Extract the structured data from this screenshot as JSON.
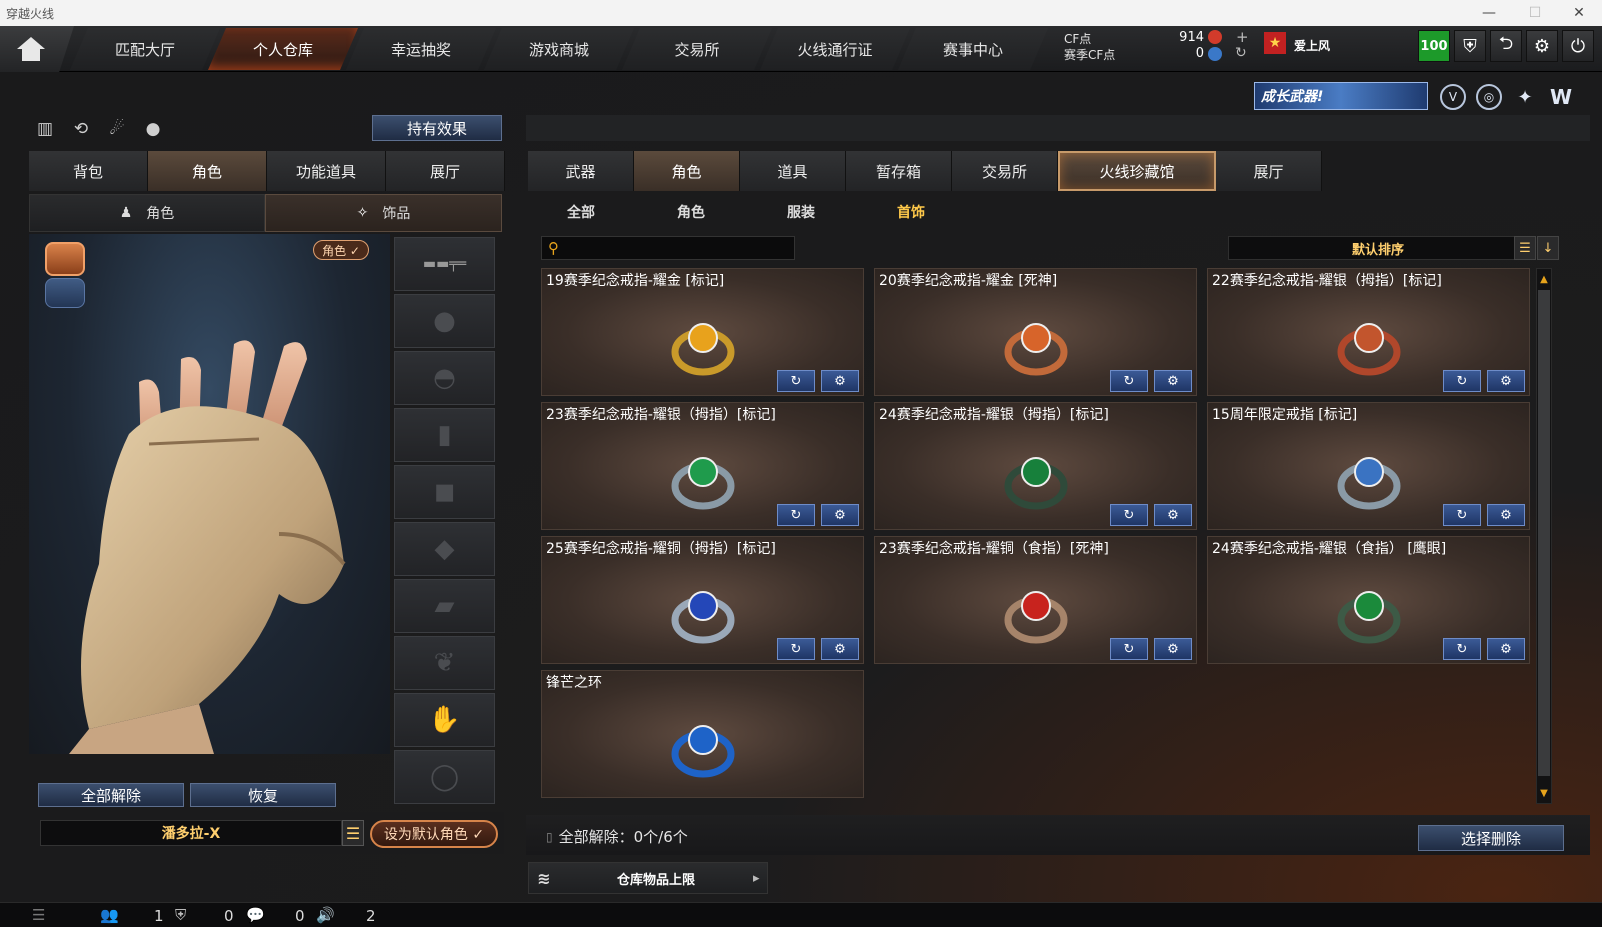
{
  "window": {
    "title": "穿越火线"
  },
  "topnav": {
    "tabs": [
      {
        "label": "匹配大厅"
      },
      {
        "label": "个人仓库"
      },
      {
        "label": "幸运抽奖"
      },
      {
        "label": "游戏商城"
      },
      {
        "label": "交易所"
      },
      {
        "label": "火线通行证"
      },
      {
        "label": "赛事中心"
      }
    ],
    "cf_label": "CF点",
    "cf_value": "914",
    "season_cf_label": "赛季CF点",
    "season_cf_value": "0",
    "username": "爱上风",
    "level_badge": "100",
    "banner_text": "成长武器!"
  },
  "left": {
    "effect_button": "持有效果",
    "tabs": [
      {
        "label": "背包"
      },
      {
        "label": "角色"
      },
      {
        "label": "功能道具"
      },
      {
        "label": "展厅"
      }
    ],
    "subtabs": [
      {
        "label": "角色"
      },
      {
        "label": "饰品"
      }
    ],
    "role_tag": "角色 ✓",
    "unequip_all": "全部解除",
    "restore": "恢复",
    "character_name": "潘多拉-X",
    "set_default": "设为默认角色 ✓"
  },
  "right": {
    "tabs": [
      {
        "label": "武器"
      },
      {
        "label": "角色"
      },
      {
        "label": "道具"
      },
      {
        "label": "暂存箱"
      },
      {
        "label": "交易所"
      },
      {
        "label": "火线珍藏馆"
      },
      {
        "label": "展厅"
      }
    ],
    "filters": [
      {
        "label": "全部"
      },
      {
        "label": "角色"
      },
      {
        "label": "服装"
      },
      {
        "label": "首饰"
      }
    ],
    "search_placeholder": "",
    "sort_label": "默认排序",
    "items": [
      {
        "title": "19赛季纪念戒指-耀金 [标记]",
        "gem": "#e8a21c",
        "band": "#c99a2a"
      },
      {
        "title": "20赛季纪念戒指-耀金 [死神]",
        "gem": "#d7642a",
        "band": "#c26a3a"
      },
      {
        "title": "22赛季纪念戒指-耀银（拇指）[标记]",
        "gem": "#c2552d",
        "band": "#b0472b"
      },
      {
        "title": "23赛季纪念戒指-耀银（拇指）[标记]",
        "gem": "#1f9b4c",
        "band": "#8a9aa6"
      },
      {
        "title": "24赛季纪念戒指-耀银（拇指）[标记]",
        "gem": "#17803b",
        "band": "#2f4a3a"
      },
      {
        "title": "15周年限定戒指 [标记]",
        "gem": "#3a73c2",
        "band": "#8a9aa6"
      },
      {
        "title": "25赛季纪念戒指-耀铜（拇指）[标记]",
        "gem": "#2447b8",
        "band": "#9aa8b8"
      },
      {
        "title": "23赛季纪念戒指-耀铜（食指）[死神]",
        "gem": "#c8231e",
        "band": "#a6846a"
      },
      {
        "title": "24赛季纪念戒指-耀银（食指） [鹰眼]",
        "gem": "#1b8a3b",
        "band": "#3d5a46"
      },
      {
        "title": "锋芒之环",
        "gem": "#1e63c8",
        "band": "#1e63c8"
      }
    ],
    "unequip_status": "全部解除：0个/6个",
    "delete_button": "选择删除",
    "capacity_label": "仓库物品上限"
  },
  "footer": {
    "count_a": "1",
    "count_b": "0",
    "count_c": "0",
    "count_d": "2"
  }
}
